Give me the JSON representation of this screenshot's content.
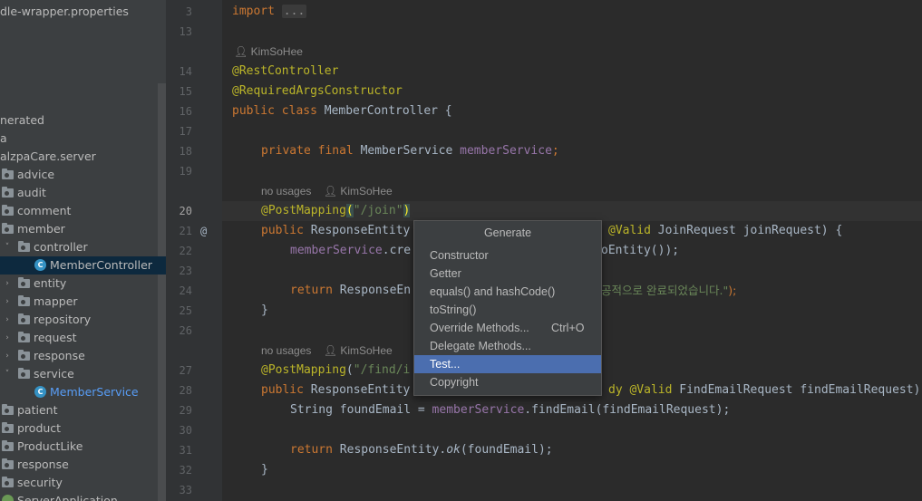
{
  "project_tree": {
    "items": [
      {
        "label": "dle-wrapper.properties",
        "kind": "file",
        "arrow": "",
        "selected": false,
        "highlight": false
      },
      {
        "label": "nerated",
        "kind": "none",
        "arrow": "",
        "selected": false,
        "highlight": false
      },
      {
        "label": "a",
        "kind": "none",
        "arrow": "",
        "selected": false,
        "highlight": false
      },
      {
        "label": "alzpaCare.server",
        "kind": "none",
        "arrow": "",
        "selected": false,
        "highlight": false
      },
      {
        "label": "advice",
        "kind": "folder",
        "arrow": "",
        "selected": false,
        "highlight": false
      },
      {
        "label": "audit",
        "kind": "folder",
        "arrow": "",
        "selected": false,
        "highlight": false
      },
      {
        "label": "comment",
        "kind": "folder",
        "arrow": "",
        "selected": false,
        "highlight": false
      },
      {
        "label": "member",
        "kind": "folder",
        "arrow": "",
        "selected": false,
        "highlight": false
      },
      {
        "label": "controller",
        "kind": "folder",
        "arrow": "˅",
        "selected": false,
        "highlight": false
      },
      {
        "label": "MemberController",
        "kind": "class",
        "arrow": "",
        "selected": true,
        "highlight": false
      },
      {
        "label": "entity",
        "kind": "folder",
        "arrow": "›",
        "selected": false,
        "highlight": false
      },
      {
        "label": "mapper",
        "kind": "folder",
        "arrow": "›",
        "selected": false,
        "highlight": false
      },
      {
        "label": "repository",
        "kind": "folder",
        "arrow": "›",
        "selected": false,
        "highlight": false
      },
      {
        "label": "request",
        "kind": "folder",
        "arrow": "›",
        "selected": false,
        "highlight": false
      },
      {
        "label": "response",
        "kind": "folder",
        "arrow": "›",
        "selected": false,
        "highlight": false
      },
      {
        "label": "service",
        "kind": "folder",
        "arrow": "˅",
        "selected": false,
        "highlight": false
      },
      {
        "label": "MemberService",
        "kind": "class",
        "arrow": "",
        "selected": false,
        "highlight": true
      },
      {
        "label": "patient",
        "kind": "folder",
        "arrow": "",
        "selected": false,
        "highlight": false
      },
      {
        "label": "product",
        "kind": "folder",
        "arrow": "",
        "selected": false,
        "highlight": false
      },
      {
        "label": "ProductLike",
        "kind": "folder",
        "arrow": "",
        "selected": false,
        "highlight": false
      },
      {
        "label": "response",
        "kind": "folder",
        "arrow": "",
        "selected": false,
        "highlight": false
      },
      {
        "label": "security",
        "kind": "folder",
        "arrow": "",
        "selected": false,
        "highlight": false
      },
      {
        "label": "ServerApplication",
        "kind": "spring",
        "arrow": "",
        "selected": false,
        "highlight": false
      }
    ]
  },
  "editor": {
    "author_hint": "KimSoHee",
    "usages_hint": "no usages",
    "at_marker": "@",
    "line_numbers": [
      "3",
      "13",
      "14",
      "15",
      "16",
      "17",
      "18",
      "19",
      "20",
      "21",
      "22",
      "23",
      "24",
      "25",
      "26",
      "27",
      "28",
      "29",
      "30",
      "31",
      "32",
      "33"
    ],
    "current_line": "20",
    "code": {
      "l3_kw": "import",
      "l3_fold": "...",
      "l14": "@RestController",
      "l15": "@RequiredArgsConstructor",
      "l16_kw": "public class",
      "l16_rest": " MemberController {",
      "l18_kw": "private final",
      "l18_type": " MemberService ",
      "l18_field": "memberService",
      "l18_end": ";",
      "l20_ann": "@PostMapping",
      "l20_open": "(",
      "l20_str": "\"/join\"",
      "l20_close": ")",
      "l21_kw": "public",
      "l21_a": " ResponseEntity",
      "l21_ann": "@Valid",
      "l21_b": " JoinRequest joinRequest) {",
      "l22_field": "memberService",
      "l22_a": ".cre",
      "l22_b": "oEntity());",
      "l24_kw": "return",
      "l24_a": " ResponseEn",
      "l24_str": "공적으로 완료되었습니다.\"",
      "l24_end": ");",
      "l25": "}",
      "l27_ann": "@PostMapping",
      "l27_open": "(",
      "l27_str": "\"/find/i",
      "l28_kw": "public",
      "l28_a": " ResponseEntity",
      "l28_ann": "dy @Valid",
      "l28_b": " FindEmailRequest findEmailRequest)",
      "l29_a": "String foundEmail = ",
      "l29_field": "memberService",
      "l29_b": ".findEmail(findEmailRequest);",
      "l31_kw": "return",
      "l31_a": " ResponseEntity.",
      "l31_it": "ok",
      "l31_b": "(foundEmail);",
      "l32": "}"
    }
  },
  "generate_popup": {
    "title": "Generate",
    "items": [
      {
        "label": "Constructor",
        "shortcut": ""
      },
      {
        "label": "Getter",
        "shortcut": ""
      },
      {
        "label": "equals() and hashCode()",
        "shortcut": ""
      },
      {
        "label": "toString()",
        "shortcut": ""
      },
      {
        "label": "Override Methods...",
        "shortcut": "Ctrl+O"
      },
      {
        "label": "Delegate Methods...",
        "shortcut": ""
      },
      {
        "label": "Test...",
        "shortcut": ""
      },
      {
        "label": "Copyright",
        "shortcut": ""
      }
    ],
    "highlighted_item": "Test..."
  },
  "colors": {
    "accent_selection": "#4b6eaf",
    "tree_selection": "#0d293e",
    "keyword": "#cc7832",
    "annotation": "#bbb529",
    "string": "#6a8759",
    "field": "#9876aa"
  }
}
